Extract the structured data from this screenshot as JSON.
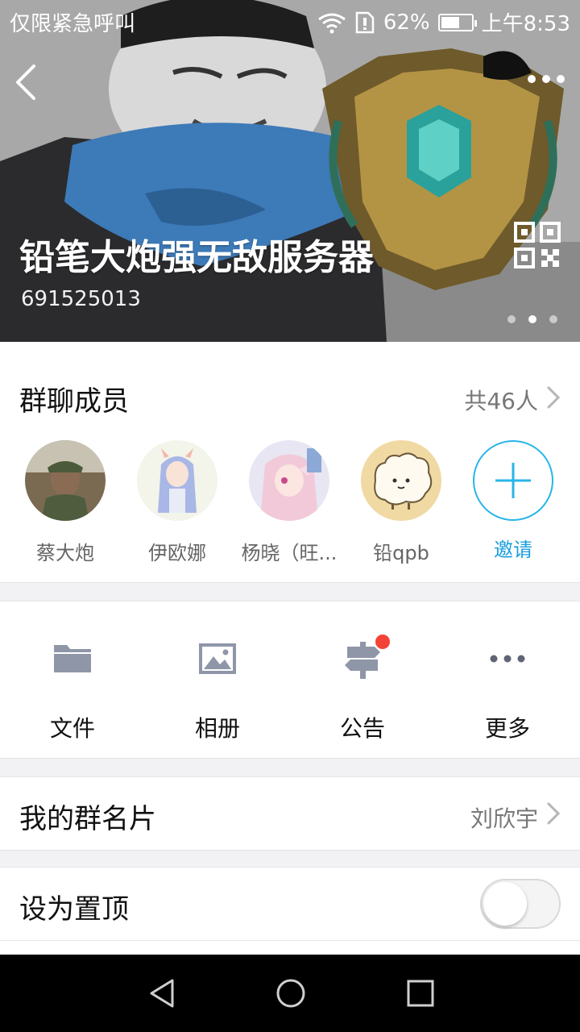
{
  "status_bar": {
    "carrier_text": "仅限紧急呼叫",
    "battery_percent": "62%",
    "battery_level": 0.62,
    "time": "上午8:53"
  },
  "header": {
    "group_name": "铅笔大炮强无敌服务器",
    "group_id": "691525013",
    "banner_page_count": 3,
    "banner_active_index": 1
  },
  "members": {
    "title": "群聊成员",
    "count_label": "共46人",
    "items": [
      {
        "name": "蔡大炮"
      },
      {
        "name": "伊欧娜"
      },
      {
        "name": "杨晓（旺..."
      },
      {
        "name": "铅qpb"
      }
    ],
    "invite_label": "邀请"
  },
  "actions": [
    {
      "label": "文件",
      "icon": "folder-icon"
    },
    {
      "label": "相册",
      "icon": "image-icon"
    },
    {
      "label": "公告",
      "icon": "signpost-icon",
      "badge": true
    },
    {
      "label": "更多",
      "icon": "more-dots-icon"
    }
  ],
  "rows": {
    "my_card": {
      "label": "我的群名片",
      "value": "刘欣宇"
    },
    "pin_top": {
      "label": "设为置顶",
      "enabled": false
    }
  },
  "colors": {
    "accent": "#28b5e8",
    "icon_gray": "#8f96a8",
    "badge_red": "#f44336"
  }
}
